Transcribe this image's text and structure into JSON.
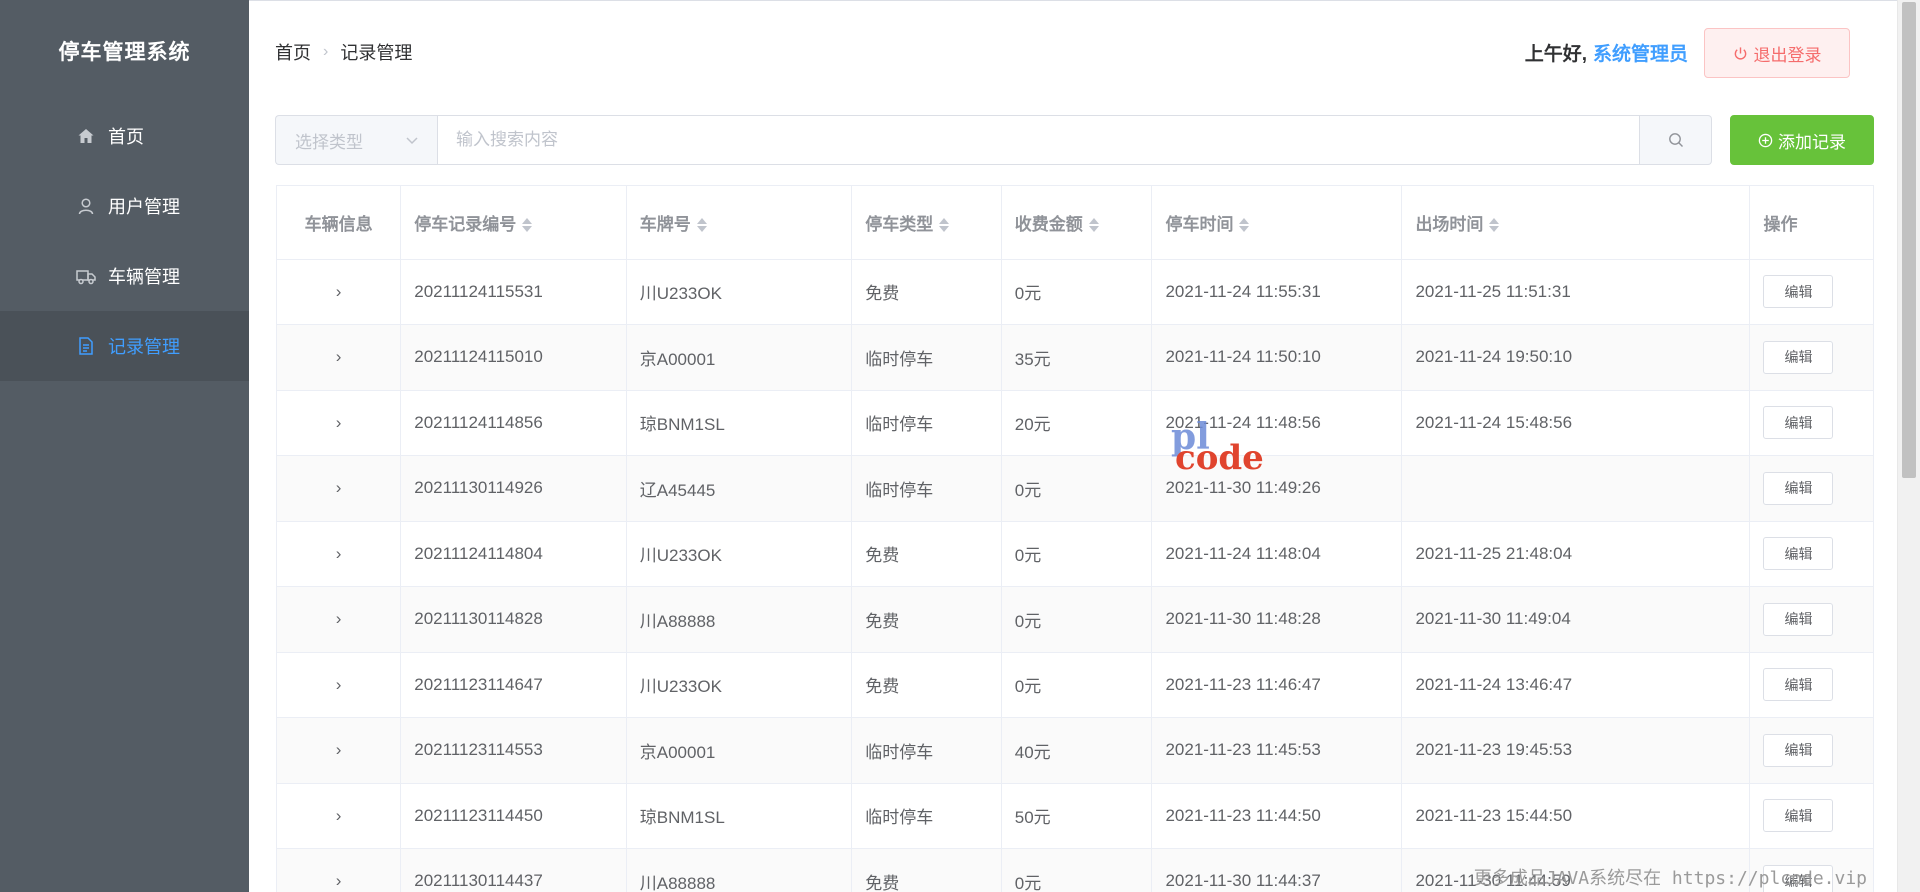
{
  "app": {
    "title": "停车管理系统"
  },
  "sidebar": {
    "items": [
      {
        "label": "首页",
        "icon": "home-icon",
        "active": false
      },
      {
        "label": "用户管理",
        "icon": "user-icon",
        "active": false
      },
      {
        "label": "车辆管理",
        "icon": "truck-icon",
        "active": false
      },
      {
        "label": "记录管理",
        "icon": "document-icon",
        "active": true
      }
    ]
  },
  "header": {
    "breadcrumb": [
      "首页",
      "记录管理"
    ],
    "greeting": "上午好,",
    "username": "系统管理员",
    "logout_label": "退出登录"
  },
  "search": {
    "type_placeholder": "选择类型",
    "input_placeholder": "输入搜索内容",
    "add_label": "添加记录"
  },
  "table": {
    "columns": [
      "车辆信息",
      "停车记录编号",
      "车牌号",
      "停车类型",
      "收费金额",
      "停车时间",
      "出场时间",
      "操作"
    ],
    "rows": [
      {
        "id": "20211124115531",
        "plate": "川U233OK",
        "type": "免费",
        "fee": "0元",
        "in": "2021-11-24 11:55:31",
        "out": "2021-11-25 11:51:31"
      },
      {
        "id": "20211124115010",
        "plate": "京A00001",
        "type": "临时停车",
        "fee": "35元",
        "in": "2021-11-24 11:50:10",
        "out": "2021-11-24 19:50:10"
      },
      {
        "id": "20211124114856",
        "plate": "琼BNM1SL",
        "type": "临时停车",
        "fee": "20元",
        "in": "2021-11-24 11:48:56",
        "out": "2021-11-24 15:48:56"
      },
      {
        "id": "20211130114926",
        "plate": "辽A45445",
        "type": "临时停车",
        "fee": "0元",
        "in": "2021-11-30 11:49:26",
        "out": ""
      },
      {
        "id": "20211124114804",
        "plate": "川U233OK",
        "type": "免费",
        "fee": "0元",
        "in": "2021-11-24 11:48:04",
        "out": "2021-11-25 21:48:04"
      },
      {
        "id": "20211130114828",
        "plate": "川A88888",
        "type": "免费",
        "fee": "0元",
        "in": "2021-11-30 11:48:28",
        "out": "2021-11-30 11:49:04"
      },
      {
        "id": "20211123114647",
        "plate": "川U233OK",
        "type": "免费",
        "fee": "0元",
        "in": "2021-11-23 11:46:47",
        "out": "2021-11-24 13:46:47"
      },
      {
        "id": "20211123114553",
        "plate": "京A00001",
        "type": "临时停车",
        "fee": "40元",
        "in": "2021-11-23 11:45:53",
        "out": "2021-11-23 19:45:53"
      },
      {
        "id": "20211123114450",
        "plate": "琼BNM1SL",
        "type": "临时停车",
        "fee": "50元",
        "in": "2021-11-23 11:44:50",
        "out": "2021-11-23 15:44:50"
      },
      {
        "id": "20211130114437",
        "plate": "川A88888",
        "type": "免费",
        "fee": "0元",
        "in": "2021-11-30 11:44:37",
        "out": "2021-11-30 11:44:59"
      }
    ],
    "edit_label": "编辑"
  },
  "watermark": {
    "line1": "pl",
    "line2": "code",
    "footer": "更多成品JAVA系统尽在 https://plcode.vip"
  },
  "colors": {
    "sidebar_bg": "#545c64",
    "active": "#409eff",
    "success": "#67c23a",
    "danger": "#f56c6c"
  }
}
